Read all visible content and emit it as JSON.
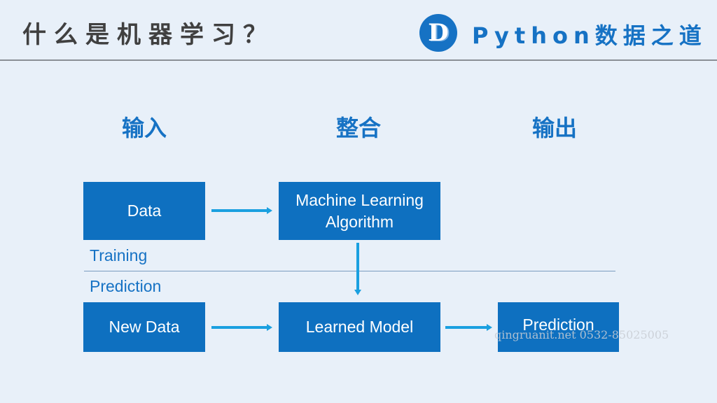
{
  "header": {
    "title": "什么是机器学习？",
    "brand": {
      "logo_letter": "D",
      "logo_icon": "d-circle-logo-icon",
      "name": "Python数据之道"
    }
  },
  "columns": {
    "input": "输入",
    "integrate": "整合",
    "output": "输出"
  },
  "phases": {
    "training": "Training",
    "prediction": "Prediction"
  },
  "nodes": {
    "data": "Data",
    "algorithm_line1": "Machine Learning",
    "algorithm_line2": "Algorithm",
    "new_data": "New Data",
    "learned_model": "Learned Model",
    "prediction": "Prediction"
  },
  "edges": [
    {
      "from": "Data",
      "to": "Machine Learning Algorithm",
      "icon": "arrow-right-icon"
    },
    {
      "from": "Machine Learning Algorithm",
      "to": "Learned Model",
      "icon": "arrow-down-icon"
    },
    {
      "from": "New Data",
      "to": "Learned Model",
      "icon": "arrow-right-icon"
    },
    {
      "from": "Learned Model",
      "to": "Prediction",
      "icon": "arrow-right-icon"
    }
  ],
  "colors": {
    "background": "#e8f0f9",
    "box_fill": "#0e70c0",
    "accent_text": "#1672c4",
    "arrow": "#1aa0e0",
    "title_text": "#404040"
  },
  "watermark": "qingruanit.net 0532-85025005"
}
